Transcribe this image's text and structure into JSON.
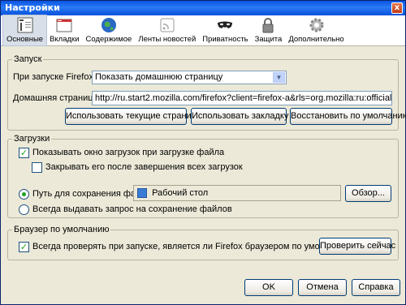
{
  "window": {
    "title": "Настройки",
    "close_glyph": "x"
  },
  "toolbar": {
    "items": [
      {
        "label": "Основные",
        "icon": "general-icon",
        "selected": true
      },
      {
        "label": "Вкладки",
        "icon": "tabs-icon"
      },
      {
        "label": "Содержимое",
        "icon": "content-globe-icon"
      },
      {
        "label": "Ленты новостей",
        "icon": "feeds-icon"
      },
      {
        "label": "Приватность",
        "icon": "privacy-mask-icon"
      },
      {
        "label": "Защита",
        "icon": "security-lock-icon"
      },
      {
        "label": "Дополнительно",
        "icon": "advanced-gear-icon"
      }
    ]
  },
  "startup": {
    "title": "Запуск",
    "on_start_label": "При запуске Firefox:",
    "on_start_value": "Показать домашнюю страницу",
    "home_label": "Домашняя страница:",
    "home_value": "http://ru.start2.mozilla.com/firefox?client=firefox-a&rls=org.mozilla:ru:official",
    "btn_current": "Использовать текущие страницы",
    "btn_bookmark": "Использовать закладку",
    "btn_default": "Восстановить по умолчанию"
  },
  "downloads": {
    "title": "Загрузки",
    "show_window_label": "Показывать окно загрузок при загрузке файла",
    "show_window_checked": true,
    "close_after_label": "Закрывать его после завершения всех загрузок",
    "close_after_checked": false,
    "save_path_label": "Путь для сохранения файлов",
    "save_path_value": "Рабочий стол",
    "browse_btn": "Обзор...",
    "always_ask_label": "Всегда выдавать запрос на сохранение файлов"
  },
  "default_browser": {
    "title": "Браузер по умолчанию",
    "check_label": "Всегда проверять при запуске, является ли Firefox браузером по умолчанию",
    "check_checked": true,
    "check_now_btn": "Проверить сейчас"
  },
  "footer": {
    "ok": "OK",
    "cancel": "Отмена",
    "help": "Справка"
  }
}
